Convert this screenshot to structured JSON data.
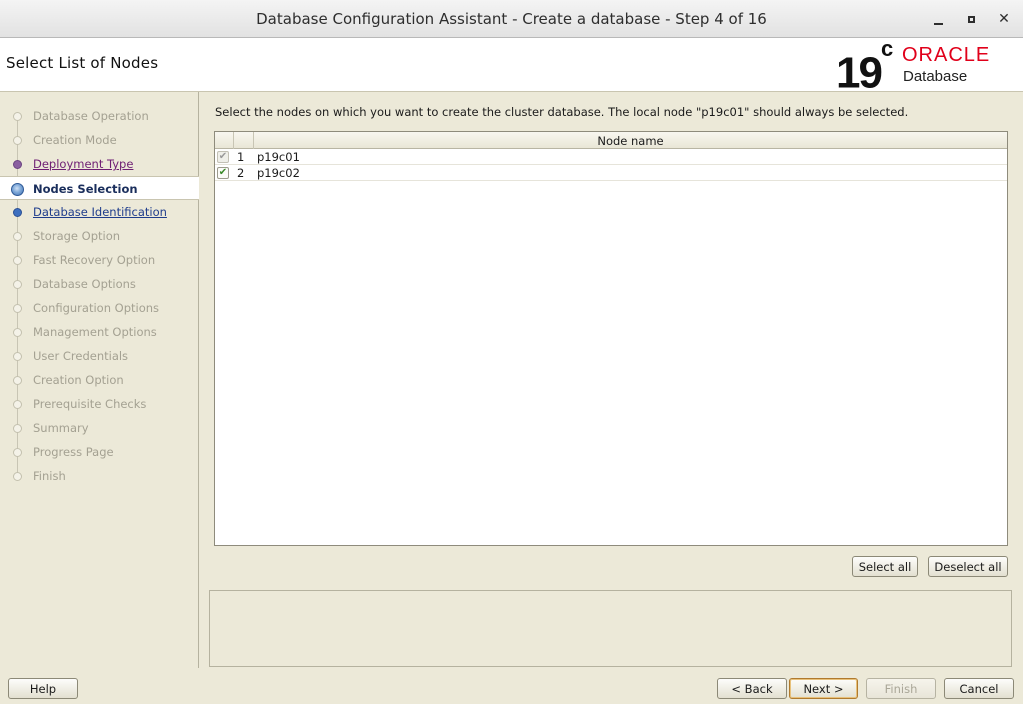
{
  "window": {
    "title": "Database Configuration Assistant - Create a database - Step 4 of 16"
  },
  "header": {
    "page_title": "Select List of Nodes",
    "logo": {
      "version": "19",
      "version_suffix": "c",
      "brand": "ORACLE",
      "product": "Database"
    }
  },
  "nav": {
    "steps": [
      {
        "label": "Database Operation",
        "state": "done"
      },
      {
        "label": "Creation Mode",
        "state": "done"
      },
      {
        "label": "Deployment Type",
        "state": "visited"
      },
      {
        "label": "Nodes Selection",
        "state": "current"
      },
      {
        "label": "Database Identification",
        "state": "next"
      },
      {
        "label": "Storage Option",
        "state": "pending"
      },
      {
        "label": "Fast Recovery Option",
        "state": "pending"
      },
      {
        "label": "Database Options",
        "state": "pending"
      },
      {
        "label": "Configuration Options",
        "state": "pending"
      },
      {
        "label": "Management Options",
        "state": "pending"
      },
      {
        "label": "User Credentials",
        "state": "pending"
      },
      {
        "label": "Creation Option",
        "state": "pending"
      },
      {
        "label": "Prerequisite Checks",
        "state": "pending"
      },
      {
        "label": "Summary",
        "state": "pending"
      },
      {
        "label": "Progress Page",
        "state": "pending"
      },
      {
        "label": "Finish",
        "state": "pending"
      }
    ]
  },
  "content": {
    "instruction": "Select the nodes on which you want to create the cluster database. The local node \"p19c01\" should always be selected.",
    "table": {
      "column_header": "Node name",
      "rows": [
        {
          "num": "1",
          "name": "p19c01",
          "checked": true,
          "locked": true
        },
        {
          "num": "2",
          "name": "p19c02",
          "checked": true,
          "locked": false
        }
      ]
    },
    "select_all": "Select all",
    "deselect_all": "Deselect all"
  },
  "footer": {
    "help": "Help",
    "back": "< Back",
    "next": "Next >",
    "finish": "Finish",
    "cancel": "Cancel"
  }
}
